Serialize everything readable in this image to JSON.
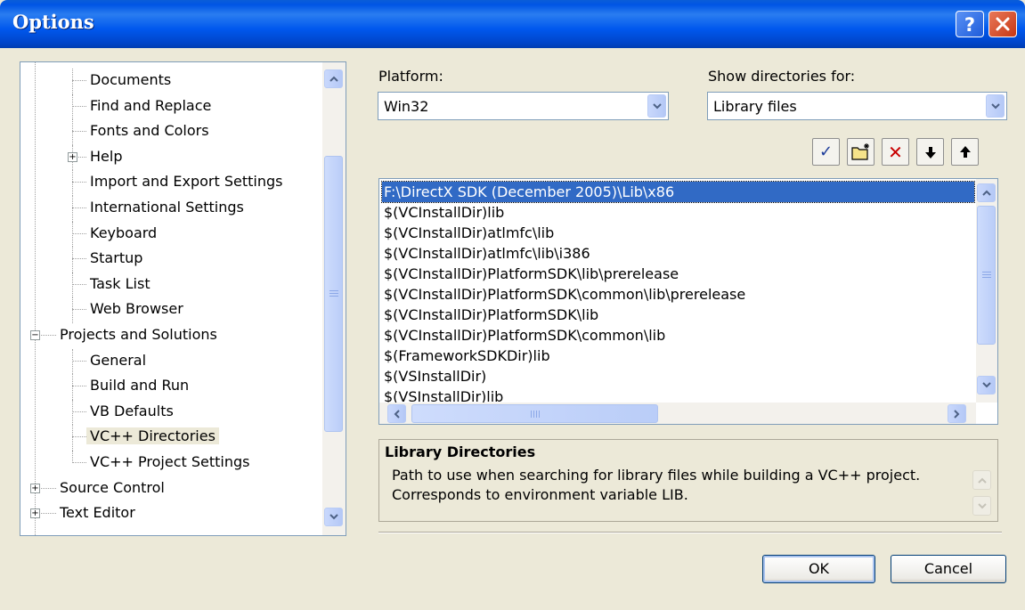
{
  "window": {
    "title": "Options"
  },
  "tree": {
    "items": [
      {
        "label": "Documents",
        "level": 2
      },
      {
        "label": "Find and Replace",
        "level": 2
      },
      {
        "label": "Fonts and Colors",
        "level": 2
      },
      {
        "label": "Help",
        "level": 2,
        "expander": "+"
      },
      {
        "label": "Import and Export Settings",
        "level": 2
      },
      {
        "label": "International Settings",
        "level": 2
      },
      {
        "label": "Keyboard",
        "level": 2
      },
      {
        "label": "Startup",
        "level": 2
      },
      {
        "label": "Task List",
        "level": 2
      },
      {
        "label": "Web Browser",
        "level": 2
      },
      {
        "label": "Projects and Solutions",
        "level": 1,
        "expander": "−"
      },
      {
        "label": "General",
        "level": 2
      },
      {
        "label": "Build and Run",
        "level": 2
      },
      {
        "label": "VB Defaults",
        "level": 2
      },
      {
        "label": "VC++ Directories",
        "level": 2,
        "selected": true
      },
      {
        "label": "VC++ Project Settings",
        "level": 2
      },
      {
        "label": "Source Control",
        "level": 1,
        "expander": "+"
      },
      {
        "label": "Text Editor",
        "level": 1,
        "expander": "+"
      }
    ]
  },
  "platform": {
    "label": "Platform:",
    "value": "Win32"
  },
  "show_dirs": {
    "label": "Show directories for:",
    "value": "Library files"
  },
  "toolbar": {
    "check_glyph": "✓",
    "delete_glyph": "✕",
    "down_glyph": "🡇",
    "up_glyph": "🡅"
  },
  "directories": [
    "F:\\DirectX SDK (December 2005)\\Lib\\x86",
    "$(VCInstallDir)lib",
    "$(VCInstallDir)atlmfc\\lib",
    "$(VCInstallDir)atlmfc\\lib\\i386",
    "$(VCInstallDir)PlatformSDK\\lib\\prerelease",
    "$(VCInstallDir)PlatformSDK\\common\\lib\\prerelease",
    "$(VCInstallDir)PlatformSDK\\lib",
    "$(VCInstallDir)PlatformSDK\\common\\lib",
    "$(FrameworkSDKDir)lib",
    "$(VSInstallDir)",
    "$(VSInstallDir)lib"
  ],
  "description": {
    "title": "Library Directories",
    "line1": "Path to use when searching for library files while building a VC++ project.",
    "line2": "Corresponds to environment variable LIB."
  },
  "buttons": {
    "ok": "OK",
    "cancel": "Cancel"
  },
  "colors": {
    "titlebar": "#0055E5",
    "selection": "#316AC5",
    "dialog": "#ECE9D8"
  }
}
